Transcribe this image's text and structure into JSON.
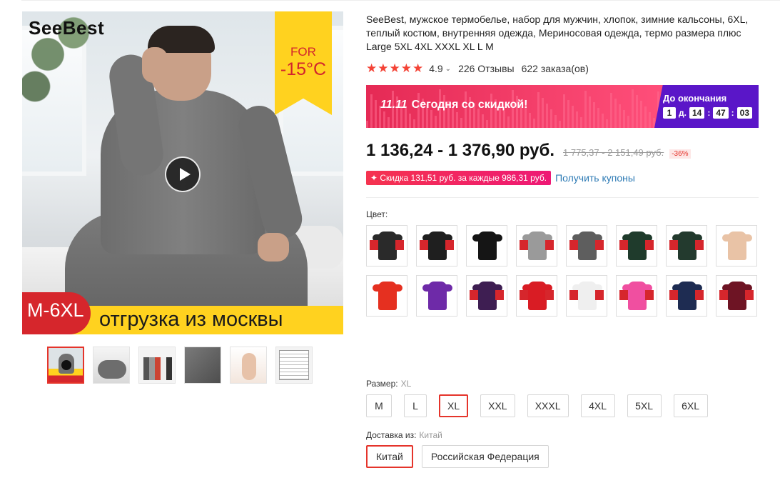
{
  "gallery": {
    "brand": "SeeBest",
    "ribbon_for": "FOR",
    "ribbon_temp": "-15°C",
    "size_badge": "M-6XL",
    "banner_text": "отгрузка из москвы"
  },
  "product": {
    "title": "SeeBest, мужское термобелье, набор для мужчин, хлопок, зимние кальсоны, 6XL, теплый костюм, внутренняя одежда, Мериносовая одежда, термо размера плюс Large 5XL 4XL XXXL XL L M",
    "stars": "★★★★★",
    "rating": "4.9",
    "reviews": "226 Отзывы",
    "orders": "622 заказа(ов)"
  },
  "promo": {
    "event": "11.11",
    "text": "Сегодня со скидкой!",
    "until_label": "До окончания",
    "days": "1",
    "days_unit": "д.",
    "hours": "14",
    "minutes": "47",
    "seconds": "03",
    "colors": {
      "left": "#e62e5a",
      "right": "#5a16c8"
    }
  },
  "price": {
    "current": "1 136,24 - 1 376,90 руб.",
    "old": "1 775,37 - 2 151,49 руб.",
    "discount": "-36%"
  },
  "coupon": {
    "text": "✦ Скидка 131,51 руб. за каждые 986,31 руб.",
    "link": "Получить купоны"
  },
  "color": {
    "label": "Цвет:",
    "swatches": [
      {
        "name": "black-grey",
        "color": "#2a2a2a"
      },
      {
        "name": "black",
        "color": "#1f1f1f"
      },
      {
        "name": "black-set",
        "color": "#151515"
      },
      {
        "name": "grey",
        "color": "#9a9a9a"
      },
      {
        "name": "dark-grey",
        "color": "#5e5e5e"
      },
      {
        "name": "green",
        "color": "#1f3b2c"
      },
      {
        "name": "dark-green",
        "color": "#233a2e"
      },
      {
        "name": "skin",
        "color": "#e9c3a6"
      },
      {
        "name": "red-set",
        "color": "#e53020"
      },
      {
        "name": "purple-set",
        "color": "#6e2aa8"
      },
      {
        "name": "purple",
        "color": "#3e1e52"
      },
      {
        "name": "red",
        "color": "#d91c24"
      },
      {
        "name": "white",
        "color": "#efefef"
      },
      {
        "name": "pink",
        "color": "#f04fa0"
      },
      {
        "name": "navy",
        "color": "#1e2c52"
      },
      {
        "name": "wine",
        "color": "#6e1424"
      }
    ]
  },
  "size": {
    "label": "Размер:",
    "selected": "XL",
    "options": [
      "M",
      "L",
      "XL",
      "XXL",
      "XXXL",
      "4XL",
      "5XL",
      "6XL"
    ]
  },
  "shipping": {
    "label": "Доставка из:",
    "selected": "Китай",
    "options": [
      "Китай",
      "Российская Федерация"
    ]
  }
}
